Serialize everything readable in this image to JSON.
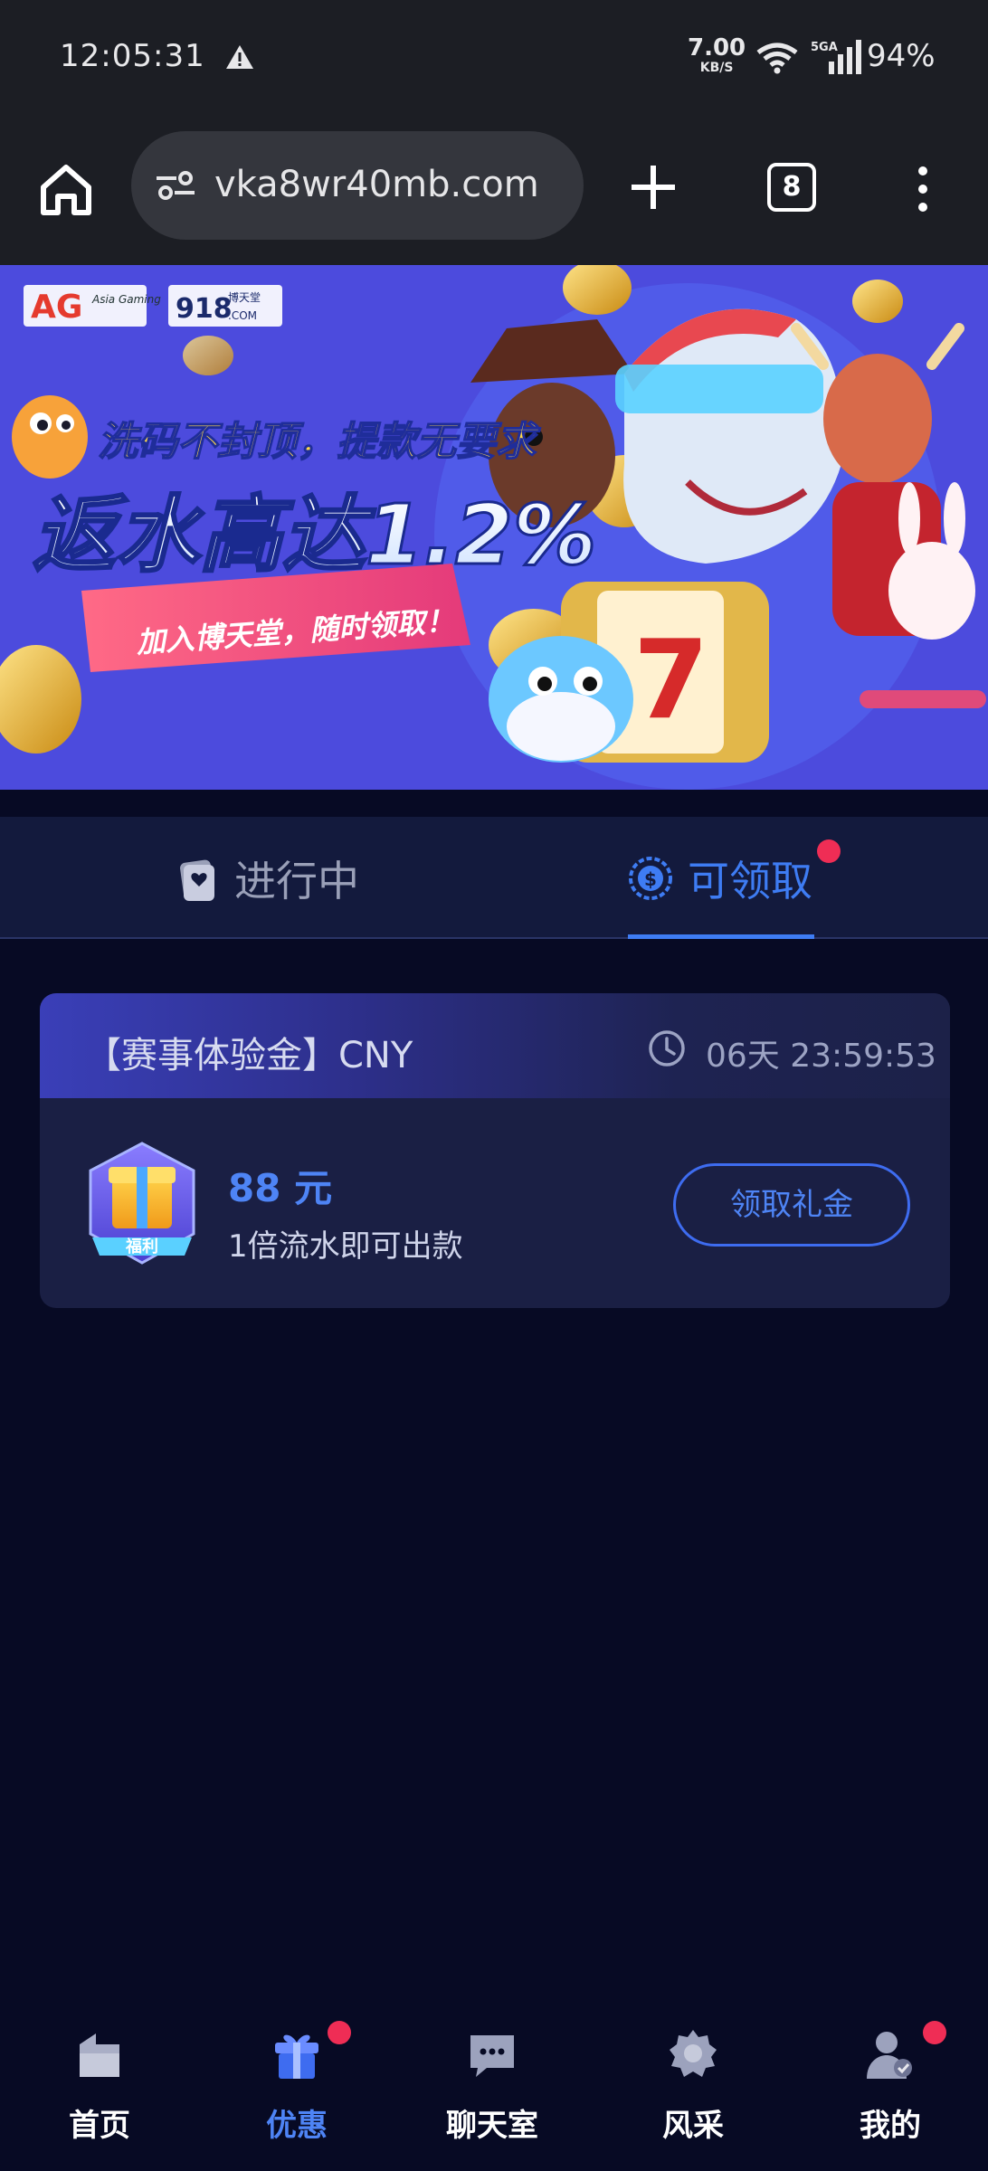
{
  "status_bar": {
    "time": "12:05:31",
    "net_speed": "7.00",
    "net_unit": "KB/S",
    "network": "5GA",
    "battery": "94%"
  },
  "browser": {
    "url": "vka8wr40mb.com",
    "tab_count": "8"
  },
  "banner": {
    "brand_ag": "AG",
    "brand_ag_sub": "Asia Gaming",
    "brand_918": "918",
    "brand_918_sub": "博天堂",
    "brand_918_com": ".COM",
    "tagline": "洗码不封顶，提款无要求",
    "headline": "返水高达1.2%",
    "cta": "加入博天堂，随时领取！"
  },
  "tabs": [
    {
      "label": "进行中",
      "active": false
    },
    {
      "label": "可领取",
      "active": true
    }
  ],
  "card": {
    "title": "【赛事体验金】CNY",
    "countdown": "06天 23:59:53",
    "badge_label": "福利",
    "amount": "88 元",
    "description": "1倍流水即可出款",
    "button_label": "领取礼金"
  },
  "bottom_nav": [
    {
      "label": "首页",
      "icon": "home-icon",
      "active": false,
      "dot": false
    },
    {
      "label": "优惠",
      "icon": "gift-icon",
      "active": true,
      "dot": true
    },
    {
      "label": "聊天室",
      "icon": "chat-icon",
      "active": false,
      "dot": false
    },
    {
      "label": "风采",
      "icon": "badge-icon",
      "active": false,
      "dot": false
    },
    {
      "label": "我的",
      "icon": "user-icon",
      "active": false,
      "dot": true
    }
  ],
  "colors": {
    "background": "#070a24",
    "accent": "#3e7cf3",
    "notification": "#ef2d55"
  }
}
